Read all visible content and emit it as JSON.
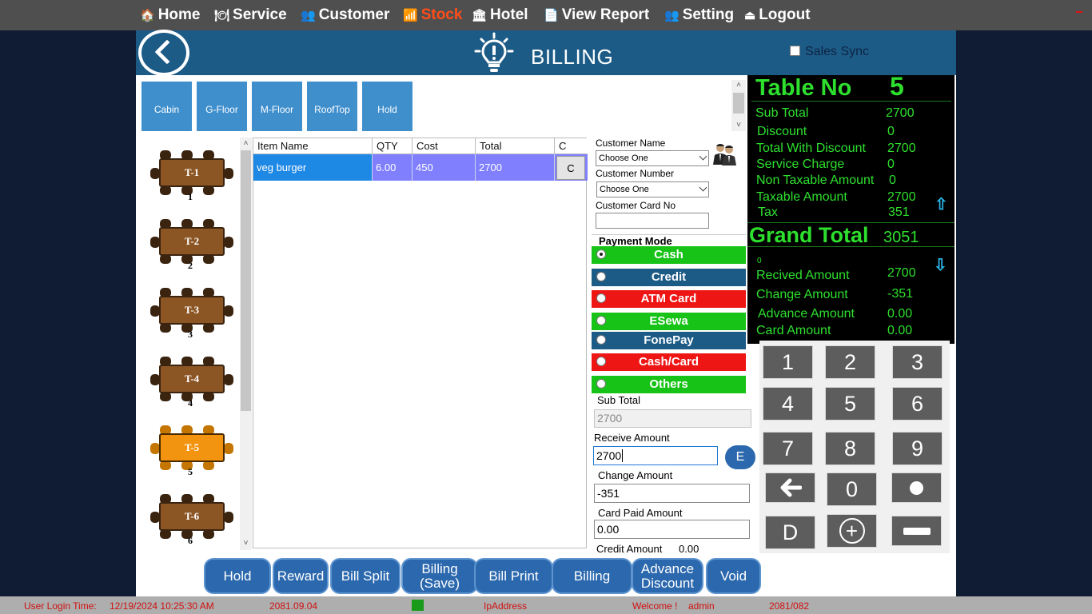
{
  "menu": [
    {
      "label": "Home",
      "icon": "home-icon",
      "glyph": "🏠"
    },
    {
      "label": "Service",
      "icon": "dish-icon",
      "glyph": "🍽"
    },
    {
      "label": "Customer",
      "icon": "users-icon",
      "glyph": "👥"
    },
    {
      "label": "Stock",
      "icon": "chart-icon",
      "glyph": "📶"
    },
    {
      "label": "Hotel",
      "icon": "building-icon",
      "glyph": "🏛"
    },
    {
      "label": "View Report",
      "icon": "report-icon",
      "glyph": "📄"
    },
    {
      "label": "Setting",
      "icon": "users-gear-icon",
      "glyph": "👥"
    },
    {
      "label": "Logout",
      "icon": "logout-icon",
      "glyph": "⏏"
    }
  ],
  "header": {
    "title": "BILLING",
    "sales_sync": "Sales Sync",
    "sales_sync_checked": false
  },
  "floors": [
    "Cabin",
    "G-Floor",
    "M-Floor",
    "RoofTop",
    "Hold"
  ],
  "tables": [
    {
      "label": "T-1",
      "number": "1",
      "selected": false
    },
    {
      "label": "T-2",
      "number": "2",
      "selected": false
    },
    {
      "label": "T-3",
      "number": "3",
      "selected": false
    },
    {
      "label": "T-4",
      "number": "4",
      "selected": false
    },
    {
      "label": "T-5",
      "number": "5",
      "selected": true
    },
    {
      "label": "T-6",
      "number": "6",
      "selected": false
    }
  ],
  "order": {
    "headers": {
      "item": "Item Name",
      "qty": "QTY",
      "cost": "Cost",
      "total": "Total",
      "c": "C"
    },
    "rows": [
      {
        "item": "veg burger",
        "qty": "6.00",
        "cost": "450",
        "total": "2700",
        "cancel": "C"
      }
    ]
  },
  "customer": {
    "name_label": "Customer Name",
    "name_value": "Choose One",
    "number_label": "Customer Number",
    "number_value": "Choose One",
    "card_label": "Customer Card No",
    "card_value": ""
  },
  "payment": {
    "title": "Payment Mode",
    "modes": [
      {
        "label": "Cash",
        "color": "#16c316",
        "selected": true
      },
      {
        "label": "Credit",
        "color": "#1d5b87",
        "selected": false
      },
      {
        "label": "ATM  Card",
        "color": "#ee1515",
        "selected": false
      },
      {
        "label": "ESewa",
        "color": "#16c316",
        "selected": false
      },
      {
        "label": "FonePay",
        "color": "#1d5b87",
        "selected": false
      },
      {
        "label": "Cash/Card",
        "color": "#ee1515",
        "selected": false
      },
      {
        "label": "Others",
        "color": "#16c316",
        "selected": false
      }
    ]
  },
  "amounts": {
    "sub_total_label": "Sub Total",
    "sub_total": "2700",
    "receive_label": "Receive Amount",
    "receive": "2700",
    "e_button": "E",
    "change_label": "Change Amount",
    "change": "-351",
    "card_paid_label": "Card Paid Amount",
    "card_paid": "0.00",
    "credit_label": "Credit Amount",
    "credit": "0.00"
  },
  "summary": {
    "table_no_label": "Table No",
    "table_no": "5",
    "sub_total_label": "Sub Total",
    "sub_total": "2700",
    "discount_label": "Discount",
    "discount": "0",
    "total_with_discount_label": "Total With Discount",
    "total_with_discount": "2700",
    "service_charge_label": "Service Charge",
    "service_charge": "0",
    "non_taxable_label": "Non Taxable Amount",
    "non_taxable": "0",
    "taxable_label": "Taxable Amount",
    "taxable": "2700",
    "tax_label": "Tax",
    "tax": "351",
    "grand_total_label": "Grand Total",
    "grand_total": "3051",
    "zero_note": "0",
    "received_label": "Recived Amount",
    "received": "2700",
    "change_label": "Change Amount",
    "change": "-351",
    "advance_label": "Advance Amount",
    "advance": "0.00",
    "card_label": "Card Amount",
    "card": "0.00"
  },
  "keypad": [
    "1",
    "2",
    "3",
    "4",
    "5",
    "6",
    "7",
    "8",
    "9",
    "←",
    "0",
    "●",
    "D",
    "+",
    "−"
  ],
  "actions": [
    {
      "label": "Hold",
      "name": "hold-button"
    },
    {
      "label": "Reward",
      "name": "reward-button"
    },
    {
      "label": "Bill Split",
      "name": "bill-split-button"
    },
    {
      "label": "Billing (Save)",
      "name": "billing-save-button"
    },
    {
      "label": "Bill Print",
      "name": "bill-print-button"
    },
    {
      "label": "Billing",
      "name": "billing-button"
    },
    {
      "label": "Advance Discount",
      "name": "advance-discount-button"
    },
    {
      "label": "Void",
      "name": "void-button"
    }
  ],
  "status": {
    "login_label": "User Login Time:",
    "login_time": "12/19/2024 10:25:30 AM",
    "date": "2081.09.04",
    "ip": "IpAddress",
    "welcome": "Welcome !",
    "user": "admin",
    "fiscal_year": "2081/082"
  }
}
